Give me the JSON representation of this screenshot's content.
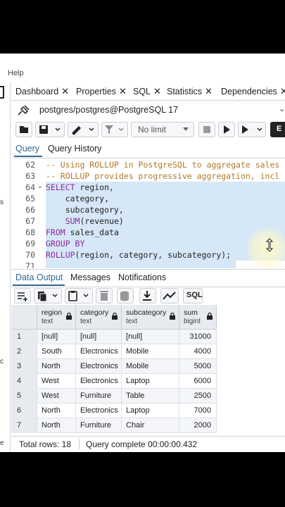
{
  "menu": {
    "help_label": "Help"
  },
  "left_strip": {
    "chars": [
      "s",
      "c",
      "e"
    ]
  },
  "top_tabs": [
    {
      "label": "Dashboard",
      "close": "✕"
    },
    {
      "label": "Properties",
      "close": "✕"
    },
    {
      "label": "SQL",
      "close": "✕"
    },
    {
      "label": "Statistics",
      "close": "✕"
    },
    {
      "label": "Dependencies",
      "close": "✕"
    }
  ],
  "connection": {
    "label": "postgres/postgres@PostgreSQL 17"
  },
  "toolbar": {
    "limit_label": "No limit",
    "explain_label": "E"
  },
  "editor_tabs": {
    "query": "Query",
    "history": "Query History"
  },
  "editor": {
    "lines": [
      {
        "num": "62",
        "text": "-- Using ROLLUP in PostgreSQL to aggregate sales"
      },
      {
        "num": "63",
        "text": "-- ROLLUP provides progressive aggregation, incl"
      },
      {
        "num": "64",
        "text": "SELECT region,"
      },
      {
        "num": "65",
        "text": "    category,"
      },
      {
        "num": "66",
        "text": "    subcategory,"
      },
      {
        "num": "67",
        "text": "    SUM(revenue)"
      },
      {
        "num": "68",
        "text": "FROM sales_data"
      },
      {
        "num": "69",
        "text": "GROUP BY"
      },
      {
        "num": "70",
        "text": "ROLLUP(region, category, subcategory);"
      },
      {
        "num": "71",
        "text": ""
      }
    ]
  },
  "result_tabs": {
    "data_output": "Data Output",
    "messages": "Messages",
    "notifications": "Notifications"
  },
  "result_toolbar": {
    "sql_label": "SQL"
  },
  "grid": {
    "columns": [
      {
        "name": "region",
        "type": "text"
      },
      {
        "name": "category",
        "type": "text"
      },
      {
        "name": "subcategory",
        "type": "text"
      },
      {
        "name": "sum",
        "type": "bigint"
      }
    ],
    "rows": [
      {
        "n": "1",
        "region": "[null]",
        "category": "[null]",
        "subcategory": "[null]",
        "sum": "31000"
      },
      {
        "n": "2",
        "region": "South",
        "category": "Electronics",
        "subcategory": "Mobile",
        "sum": "4000"
      },
      {
        "n": "3",
        "region": "North",
        "category": "Electronics",
        "subcategory": "Mobile",
        "sum": "5000"
      },
      {
        "n": "4",
        "region": "West",
        "category": "Electronics",
        "subcategory": "Laptop",
        "sum": "6000"
      },
      {
        "n": "5",
        "region": "West",
        "category": "Furniture",
        "subcategory": "Table",
        "sum": "2500"
      },
      {
        "n": "6",
        "region": "North",
        "category": "Electronics",
        "subcategory": "Laptop",
        "sum": "7000"
      },
      {
        "n": "7",
        "region": "North",
        "category": "Furniture",
        "subcategory": "Chair",
        "sum": "2000"
      }
    ]
  },
  "status": {
    "total_rows": "Total rows: 18",
    "query_complete": "Query complete 00:00:00.432"
  },
  "colors": {
    "accent": "#326690",
    "selection": "#d6e7f7",
    "comment": "#b07a2a",
    "keyword": "#8a2a9e"
  }
}
